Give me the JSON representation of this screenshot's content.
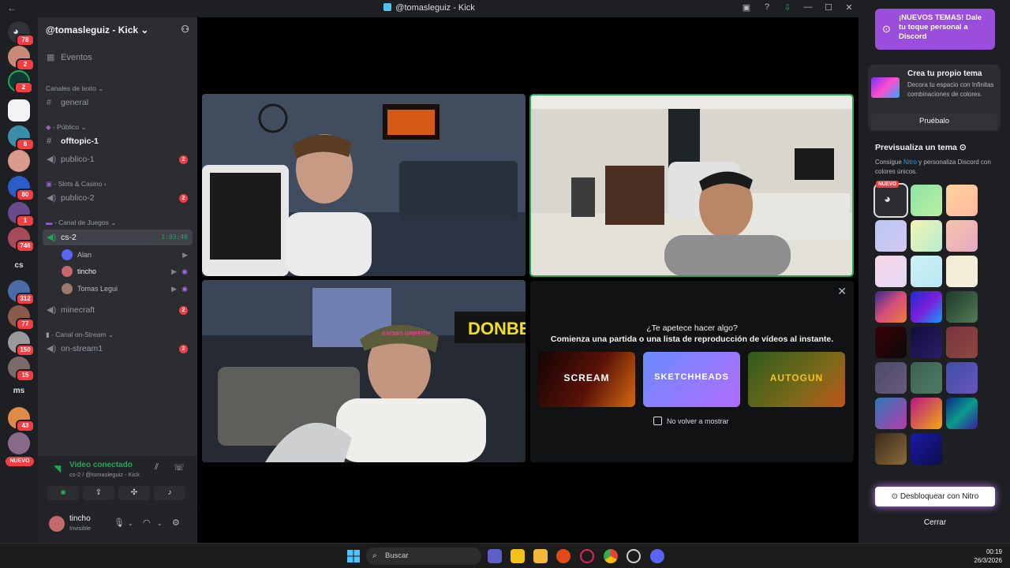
{
  "window": {
    "title": "@tomasleguiz - Kick"
  },
  "server": {
    "name": "@tomasleguiz - Kick"
  },
  "guild_badges": [
    "78",
    "2",
    "2",
    "8",
    "80",
    "1",
    "746",
    "312",
    "77",
    "150",
    "15",
    "43"
  ],
  "guild_texts": {
    "cs": "cs",
    "ms": "ms"
  },
  "guild_new_label": "NUEVO",
  "channels": {
    "events": "Eventos",
    "text_category": "Canales de texto",
    "general": "general",
    "public_category": "Público",
    "offtopic": "offtopic-1",
    "publico1": "publico-1",
    "publico1_count": "2",
    "slots_category": "Slots & Casino",
    "publico2": "publico-2",
    "publico2_count": "2",
    "games_category": "Canal de Juegos",
    "cs2": "cs-2",
    "cs2_timer": "1:03:48",
    "voice_users": [
      "Alan",
      "tincho",
      "Tomas Legui"
    ],
    "minecraft": "minecraft",
    "minecraft_count": "2",
    "stream_category": "Canal on-Stream",
    "onstream": "on-stream1",
    "onstream_count": "2"
  },
  "voice": {
    "status": "Video conectado",
    "sub": "cs-2 / @tomasleguiz - Kick"
  },
  "user": {
    "name": "tincho",
    "status": "Invisible"
  },
  "activity": {
    "question": "¿Te apetece hacer algo?",
    "subtitle": "Comienza una partida o una lista de reproducción de vídeos al instante.",
    "games": [
      "SCREAM",
      "SKETCHHEADS",
      "AUTOGUN"
    ],
    "dont_show": "No volver a mostrar"
  },
  "video_text": {
    "sign": "DONBE",
    "cap": "KNOWS GRIFFITH"
  },
  "sidebar": {
    "promo": "¡NUEVOS TEMAS! Dale tu toque personal a Discord",
    "card_title": "Crea tu propio tema",
    "card_desc": "Decora tu espacio con Infinitas combinaciones de colores.",
    "card_button": "Pruébalo",
    "preview_title": "Previsualiza un tema",
    "preview_desc_pre": "Consigue",
    "preview_desc_nitro": "Nitro",
    "preview_desc_post": "y personaliza Discord con colores únicos.",
    "new_badge": "NUEVO",
    "unlock": "Desbloquear con Nitro",
    "close": "Cerrar",
    "swatches": [
      "#2b2d31",
      "linear-gradient(135deg,#8fe0a6,#b9f1a0)",
      "linear-gradient(135deg,#ffd39a,#ffb8a1)",
      "linear-gradient(135deg,#b6c8f2,#d6c7f4)",
      "linear-gradient(135deg,#f4f3b3,#b6ecd0)",
      "linear-gradient(135deg,#f6c5a8,#e3a9c4)",
      "linear-gradient(135deg,#f8d6e6,#e3d8f7)",
      "linear-gradient(135deg,#cdf1f5,#b8e7f2)",
      "linear-gradient(135deg,#f4ecd0,#f1efdc)",
      "linear-gradient(135deg,#3b2a8f,#d54f7a,#f07b3a)",
      "linear-gradient(135deg,#1b2bd0,#7b1fd9,#0fa0ff)",
      "linear-gradient(135deg,#1c3a2a,#547a55)",
      "linear-gradient(135deg,#3a0008,#0b0b0b)",
      "linear-gradient(135deg,#0f0f3a,#2c1c6b)",
      "linear-gradient(135deg,#7a3340,#8b4a3d)",
      "linear-gradient(135deg,#4a4a6a,#6b5b7b)",
      "linear-gradient(135deg,#3e6350,#4d7a64)",
      "linear-gradient(135deg,#3d4fa8,#6a56b8)",
      "linear-gradient(135deg,#2a7ab8,#b83aa8)",
      "linear-gradient(135deg,#b8168a,#f2a90f)",
      "linear-gradient(135deg,#0d2a8a,#0b9a8a,#3a1d9a)",
      "linear-gradient(135deg,#3a2a1a,#8a6a3a)",
      "linear-gradient(135deg,#1a1aa8,#0d0d4a)"
    ]
  },
  "taskbar": {
    "search": "Buscar",
    "time": "00:19",
    "date": "26/3/2026"
  }
}
